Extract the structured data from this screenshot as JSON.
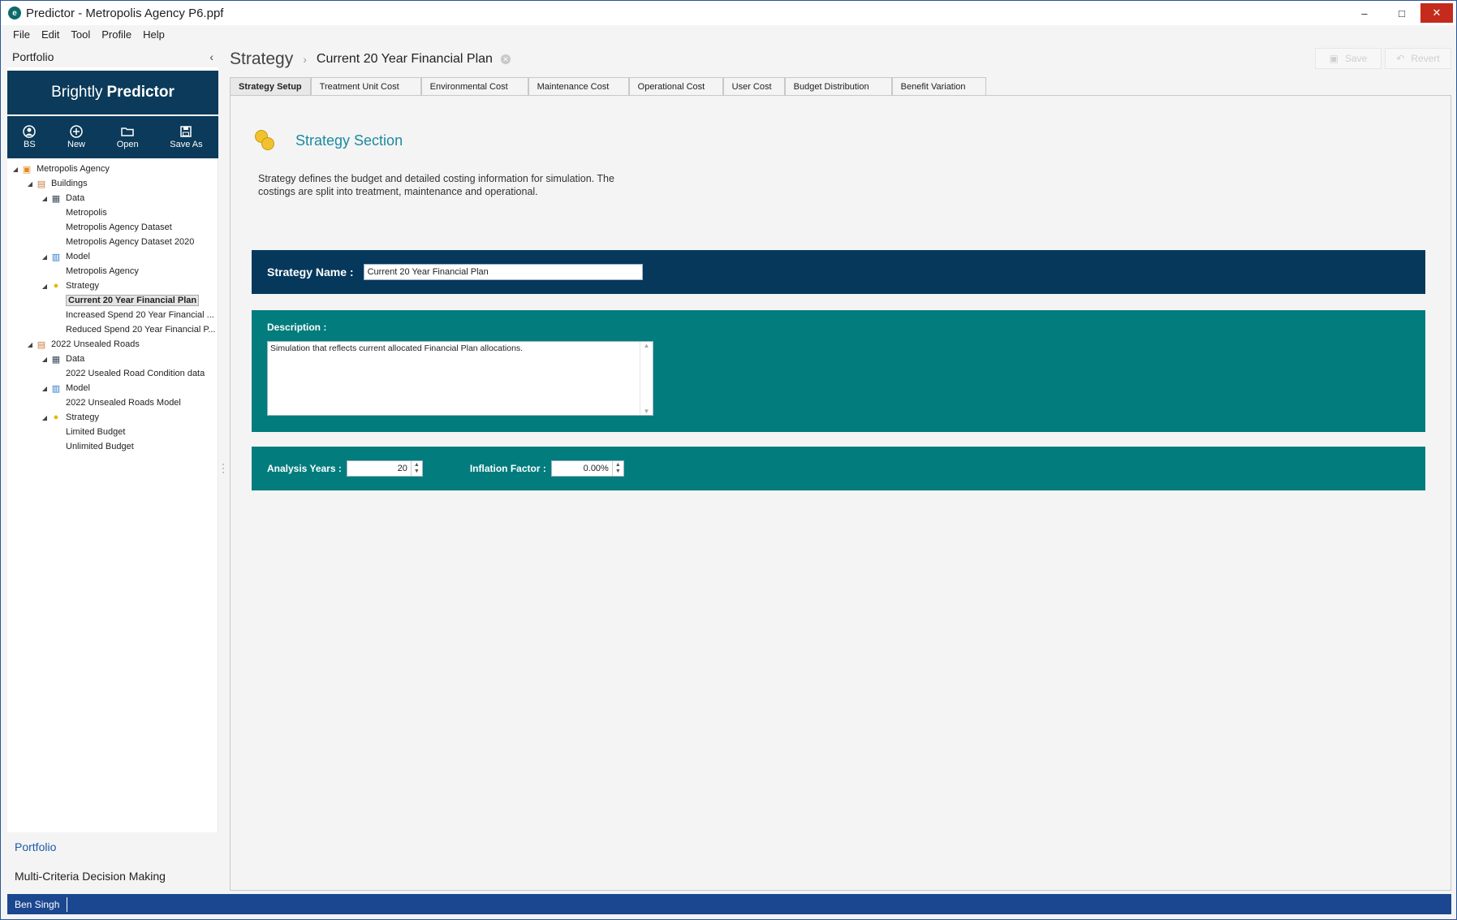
{
  "window": {
    "title": "Predictor - Metropolis Agency P6.ppf",
    "minimize": "–",
    "maximize": "□",
    "close": "✕"
  },
  "menu": [
    "File",
    "Edit",
    "Tool",
    "Profile",
    "Help"
  ],
  "left_panel": {
    "header": "Portfolio",
    "collapse_glyph": "‹",
    "brand_light": "Brightly",
    "brand_bold": "Predictor",
    "tools": [
      {
        "label": "BS",
        "icon": "user-icon"
      },
      {
        "label": "New",
        "icon": "plus-icon"
      },
      {
        "label": "Open",
        "icon": "folder-icon"
      },
      {
        "label": "Save As",
        "icon": "save-icon"
      }
    ],
    "tree": [
      {
        "label": "Metropolis Agency",
        "expander": "◢",
        "icon": "agency-icon"
      },
      {
        "label": "Buildings",
        "expander": "◢",
        "icon": "buildings-icon"
      },
      {
        "label": "Data",
        "expander": "◢",
        "icon": "database-icon"
      },
      {
        "label": "Metropolis",
        "expander": "",
        "icon": ""
      },
      {
        "label": "Metropolis Agency Dataset",
        "expander": "",
        "icon": ""
      },
      {
        "label": "Metropolis Agency Dataset 2020",
        "expander": "",
        "icon": ""
      },
      {
        "label": "Model",
        "expander": "◢",
        "icon": "model-icon"
      },
      {
        "label": "Metropolis Agency",
        "expander": "",
        "icon": ""
      },
      {
        "label": "Strategy",
        "expander": "◢",
        "icon": "strategy-icon"
      },
      {
        "label": "Current 20 Year Financial Plan",
        "expander": "",
        "icon": "",
        "selected": true
      },
      {
        "label": "Increased Spend 20 Year Financial ...",
        "expander": "",
        "icon": ""
      },
      {
        "label": "Reduced Spend 20 Year Financial P...",
        "expander": "",
        "icon": ""
      },
      {
        "label": "2022 Unsealed Roads",
        "expander": "◢",
        "icon": "buildings-icon"
      },
      {
        "label": "Data",
        "expander": "◢",
        "icon": "database-icon"
      },
      {
        "label": "2022 Usealed Road Condition data",
        "expander": "",
        "icon": ""
      },
      {
        "label": "Model",
        "expander": "◢",
        "icon": "model-icon"
      },
      {
        "label": "2022 Unsealed Roads Model",
        "expander": "",
        "icon": ""
      },
      {
        "label": "Strategy",
        "expander": "◢",
        "icon": "strategy-icon"
      },
      {
        "label": "Limited Budget",
        "expander": "",
        "icon": ""
      },
      {
        "label": "Unlimited Budget",
        "expander": "",
        "icon": ""
      }
    ],
    "bottom_nav": [
      "Portfolio",
      "Multi-Criteria Decision Making"
    ]
  },
  "breadcrumb": {
    "root": "Strategy",
    "separator": "›",
    "current": "Current 20 Year Financial Plan"
  },
  "actions": {
    "save": "Save",
    "revert": "Revert"
  },
  "tabs": [
    "Strategy Setup",
    "Treatment Unit Cost",
    "Environmental Cost",
    "Maintenance Cost",
    "Operational Cost",
    "User Cost",
    "Budget Distribution",
    "Benefit Variation"
  ],
  "section": {
    "title": "Strategy Section",
    "description": "Strategy defines the budget and detailed costing information for simulation. The costings are split into treatment, maintenance and operational."
  },
  "form": {
    "name_label": "Strategy Name :",
    "name_value": "Current 20 Year Financial Plan",
    "description_label": "Description :",
    "description_value": "Simulation that reflects current allocated Financial Plan allocations.",
    "analysis_years_label": "Analysis Years :",
    "analysis_years_value": "20",
    "inflation_label": "Inflation Factor :",
    "inflation_value": "0.00%"
  },
  "status": {
    "user": "Ben Singh"
  }
}
